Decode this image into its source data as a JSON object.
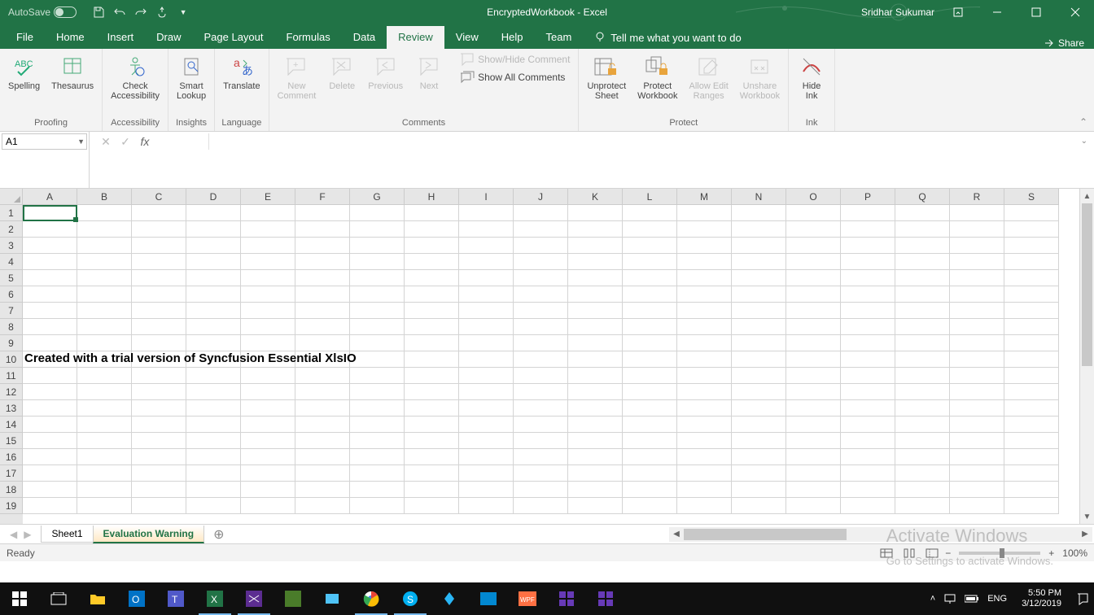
{
  "titlebar": {
    "autosave_label": "AutoSave",
    "autosave_state": "Off",
    "document_title": "EncryptedWorkbook - Excel",
    "user_name": "Sridhar Sukumar"
  },
  "tabs": {
    "file": "File",
    "home": "Home",
    "insert": "Insert",
    "draw": "Draw",
    "page_layout": "Page Layout",
    "formulas": "Formulas",
    "data": "Data",
    "review": "Review",
    "view": "View",
    "help": "Help",
    "team": "Team",
    "tellme": "Tell me what you want to do",
    "share": "Share"
  },
  "ribbon": {
    "proofing": {
      "label": "Proofing",
      "spelling": "Spelling",
      "thesaurus": "Thesaurus"
    },
    "accessibility": {
      "label": "Accessibility",
      "check1": "Check",
      "check2": "Accessibility"
    },
    "insights": {
      "label": "Insights",
      "smart1": "Smart",
      "smart2": "Lookup"
    },
    "language": {
      "label": "Language",
      "translate": "Translate"
    },
    "comments": {
      "label": "Comments",
      "new1": "New",
      "new2": "Comment",
      "delete": "Delete",
      "previous": "Previous",
      "next": "Next",
      "showhide": "Show/Hide Comment",
      "showall": "Show All Comments"
    },
    "protect": {
      "label": "Protect",
      "unprotect1": "Unprotect",
      "unprotect2": "Sheet",
      "protect1": "Protect",
      "protect2": "Workbook",
      "allow1": "Allow Edit",
      "allow2": "Ranges",
      "unshare1": "Unshare",
      "unshare2": "Workbook"
    },
    "ink": {
      "label": "Ink",
      "hide1": "Hide",
      "hide2": "Ink"
    }
  },
  "formula_bar": {
    "namebox": "A1"
  },
  "grid": {
    "columns": [
      "A",
      "B",
      "C",
      "D",
      "E",
      "F",
      "G",
      "H",
      "I",
      "J",
      "K",
      "L",
      "M",
      "N",
      "O",
      "P",
      "Q",
      "R",
      "S"
    ],
    "rows": [
      "1",
      "2",
      "3",
      "4",
      "5",
      "6",
      "7",
      "8",
      "9",
      "10",
      "11",
      "12",
      "13",
      "14",
      "15",
      "16",
      "17",
      "18",
      "19"
    ],
    "row10_text": "Created with a trial version of Syncfusion Essential XlsIO"
  },
  "sheets": {
    "sheet1": "Sheet1",
    "eval": "Evaluation Warning"
  },
  "statusbar": {
    "ready": "Ready",
    "zoom": "100%"
  },
  "watermark": {
    "line1": "Activate Windows",
    "line2": "Go to Settings to activate Windows."
  },
  "taskbar": {
    "lang": "ENG",
    "time": "5:50 PM",
    "date": "3/12/2019"
  }
}
